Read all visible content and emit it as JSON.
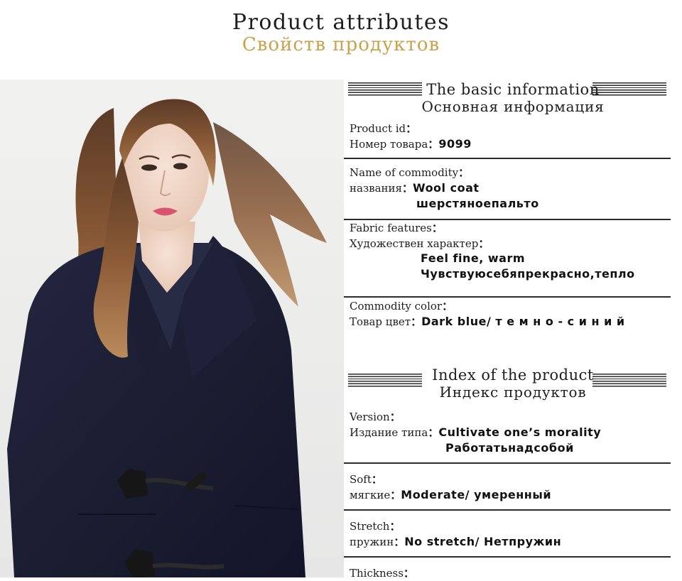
{
  "header": {
    "title_en": "Product attributes",
    "title_ru": "Свойств продуктов"
  },
  "section_basic": {
    "title_en": "The basic information",
    "title_ru": "Основная информация"
  },
  "section_index": {
    "title_en": "Index of the product",
    "title_ru": "Индекс продуктов"
  },
  "basic": {
    "product_id": {
      "label_en": "Product id",
      "label_ru": "Номер товара",
      "value": "9099"
    },
    "commodity_name": {
      "label_en": "Name of commodity",
      "label_ru": "названия",
      "value": "Wool coat",
      "value_ru": "шерстяноепальто"
    },
    "fabric": {
      "label_en": "Fabric features",
      "label_ru": "Художествен характер",
      "value": "Feel fine, warm",
      "value_ru": "Чувствуюсебяпрекрасно,тепло"
    },
    "color": {
      "label_en": "Commodity color",
      "label_ru": "Товар цвет",
      "value": "Dark blue/ т е м н о - с и н и й"
    }
  },
  "index": {
    "version": {
      "label_en": "Version",
      "label_ru": "Издание типа",
      "value": "Cultivate one’s morality",
      "value_ru": "Работатьнадсобой"
    },
    "soft": {
      "label_en": "Soft",
      "label_ru": "мягкие",
      "value": "Moderate/ умеренный"
    },
    "stretch": {
      "label_en": "Stretch",
      "label_ru": "пружин",
      "value": "No stretch/ Нетпружин"
    },
    "thickness": {
      "label_en": "Thickness"
    }
  },
  "colon": "："
}
